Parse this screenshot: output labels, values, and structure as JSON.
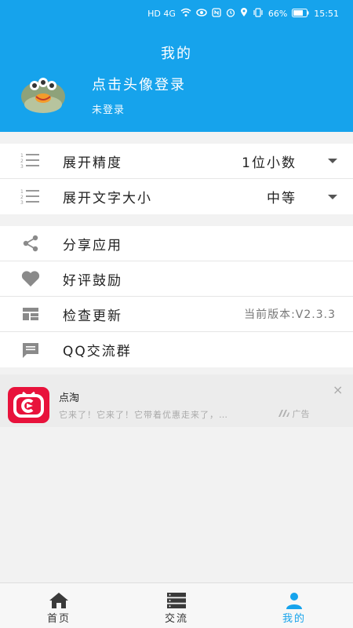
{
  "status_bar": {
    "network": "HD 4G",
    "battery": "66%",
    "time": "15:51"
  },
  "header": {
    "title": "我的",
    "login_prompt": "点击头像登录",
    "login_status": "未登录"
  },
  "settings": [
    {
      "icon": "list-icon",
      "label": "展开精度",
      "value": "1位小数"
    },
    {
      "icon": "list-icon",
      "label": "展开文字大小",
      "value": "中等"
    }
  ],
  "actions": [
    {
      "icon": "share-icon",
      "label": "分享应用"
    },
    {
      "icon": "heart-icon",
      "label": "好评鼓励"
    },
    {
      "icon": "dashboard-icon",
      "label": "检查更新",
      "extra": "当前版本:V2.3.3"
    },
    {
      "icon": "chat-icon",
      "label": "QQ交流群"
    }
  ],
  "ad": {
    "title": "点淘",
    "description": "它来了！它来了！它带着优惠走来了，…",
    "tag": "广告",
    "close": "×"
  },
  "bottom_nav": [
    {
      "label": "首页",
      "icon": "home-icon"
    },
    {
      "label": "交流",
      "icon": "server-icon"
    },
    {
      "label": "我的",
      "icon": "person-icon",
      "active": true
    }
  ],
  "colors": {
    "primary": "#16a3ec",
    "ad_logo": "#e8123b"
  }
}
